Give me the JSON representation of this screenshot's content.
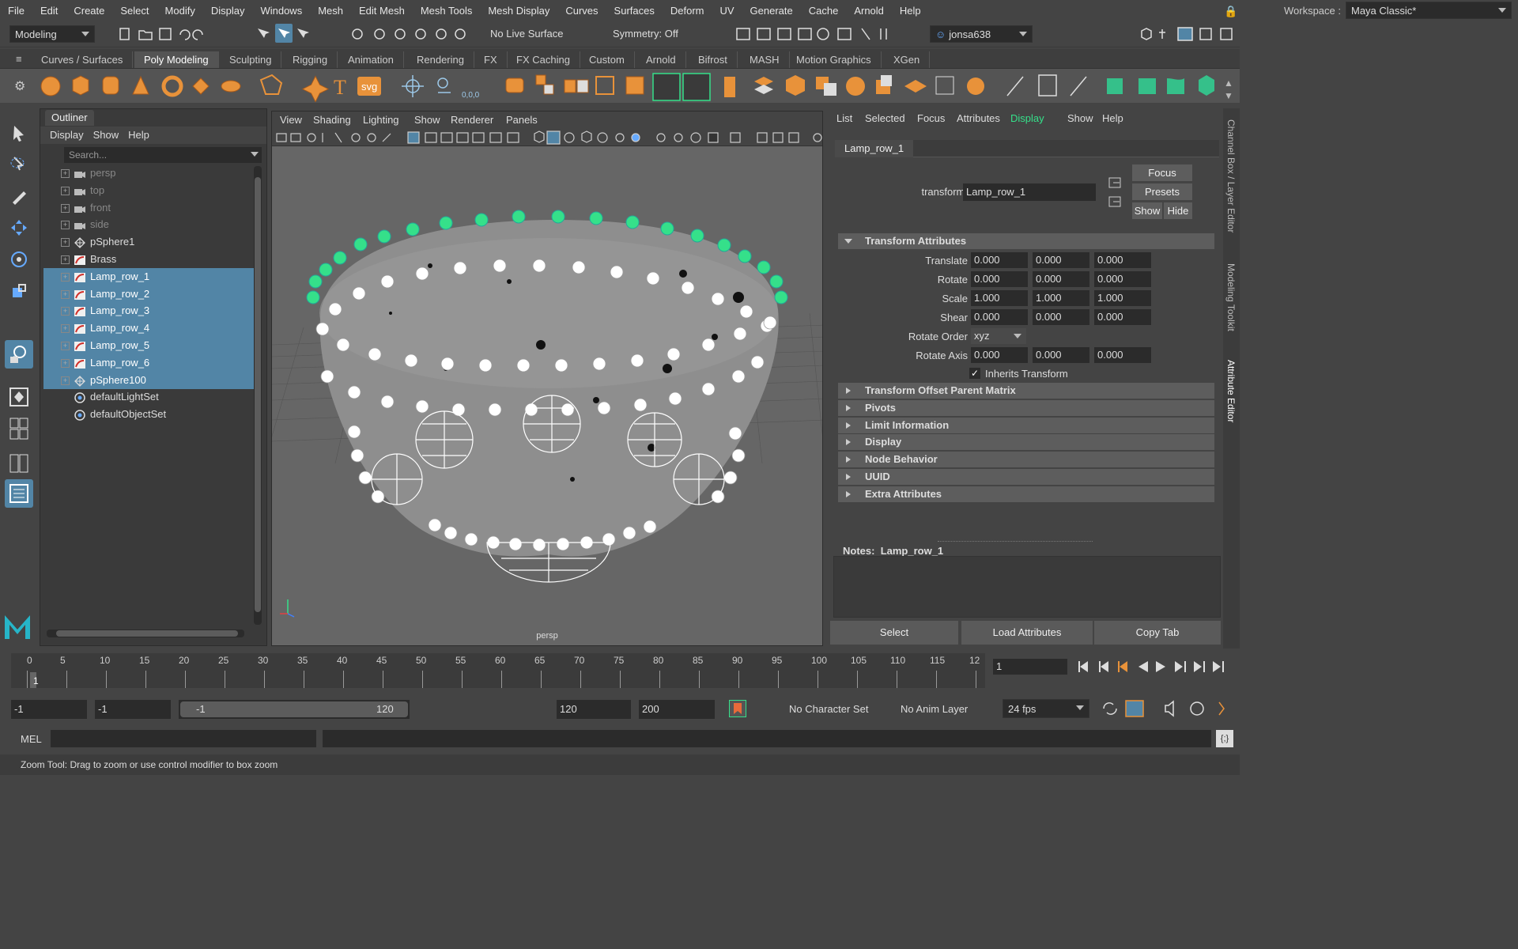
{
  "menubar": {
    "items": [
      "File",
      "Edit",
      "Create",
      "Select",
      "Modify",
      "Display",
      "Windows",
      "Mesh",
      "Edit Mesh",
      "Mesh Tools",
      "Mesh Display",
      "Curves",
      "Surfaces",
      "Deform",
      "UV",
      "Generate",
      "Cache",
      "Arnold",
      "Help"
    ],
    "workspace_label": "Workspace :",
    "workspace_value": "Maya Classic*"
  },
  "statusline": {
    "mode": "Modeling",
    "live_surface": "No Live Surface",
    "symmetry": "Symmetry: Off",
    "user": "jonsa638"
  },
  "shelf": {
    "tabs": [
      "Curves / Surfaces",
      "Poly Modeling",
      "Sculpting",
      "Rigging",
      "Animation",
      "Rendering",
      "FX",
      "FX Caching",
      "Custom",
      "Arnold",
      "Bifrost",
      "MASH",
      "Motion Graphics",
      "XGen"
    ],
    "active_tab": "Poly Modeling",
    "text_icons": {
      "type": "T",
      "svg": "svg",
      "coords": "0,0,0"
    }
  },
  "outliner": {
    "title": "Outliner",
    "menu": [
      "Display",
      "Show",
      "Help"
    ],
    "search_placeholder": "Search...",
    "rows": [
      {
        "name": "persp",
        "icon": "camera-icon",
        "selected": false,
        "dim": true,
        "expandable": true
      },
      {
        "name": "top",
        "icon": "camera-icon",
        "selected": false,
        "dim": true,
        "expandable": true
      },
      {
        "name": "front",
        "icon": "camera-icon",
        "selected": false,
        "dim": true,
        "expandable": true
      },
      {
        "name": "side",
        "icon": "camera-icon",
        "selected": false,
        "dim": true,
        "expandable": true
      },
      {
        "name": "pSphere1",
        "icon": "mesh-icon",
        "selected": false,
        "dim": false,
        "expandable": true
      },
      {
        "name": "Brass",
        "icon": "curve-icon",
        "selected": false,
        "dim": false,
        "expandable": true
      },
      {
        "name": "Lamp_row_1",
        "icon": "curve-icon",
        "selected": true,
        "dim": false,
        "expandable": true
      },
      {
        "name": "Lamp_row_2",
        "icon": "curve-icon",
        "selected": true,
        "dim": false,
        "expandable": true
      },
      {
        "name": "Lamp_row_3",
        "icon": "curve-icon",
        "selected": true,
        "dim": false,
        "expandable": true
      },
      {
        "name": "Lamp_row_4",
        "icon": "curve-icon",
        "selected": true,
        "dim": false,
        "expandable": true
      },
      {
        "name": "Lamp_row_5",
        "icon": "curve-icon",
        "selected": true,
        "dim": false,
        "expandable": true
      },
      {
        "name": "Lamp_row_6",
        "icon": "curve-icon",
        "selected": true,
        "dim": false,
        "expandable": true
      },
      {
        "name": "pSphere100",
        "icon": "mesh-icon",
        "selected": true,
        "dim": false,
        "expandable": true
      },
      {
        "name": "defaultLightSet",
        "icon": "set-icon",
        "selected": false,
        "dim": false,
        "expandable": false
      },
      {
        "name": "defaultObjectSet",
        "icon": "set-icon",
        "selected": false,
        "dim": false,
        "expandable": false
      }
    ]
  },
  "viewport": {
    "menu": [
      "View",
      "Shading",
      "Lighting",
      "Show",
      "Renderer",
      "Panels"
    ],
    "camera_label": "persp"
  },
  "attribute_editor": {
    "menu": [
      "List",
      "Selected",
      "Focus",
      "Attributes",
      "Display",
      "Show",
      "Help"
    ],
    "active_menu": "Display",
    "tab": "Lamp_row_1",
    "transform_label": "transform:",
    "transform_value": "Lamp_row_1",
    "buttons": {
      "focus": "Focus",
      "presets": "Presets",
      "show": "Show",
      "hide": "Hide"
    },
    "transform_section": "Transform Attributes",
    "translate": {
      "label": "Translate",
      "x": "0.000",
      "y": "0.000",
      "z": "0.000"
    },
    "rotate": {
      "label": "Rotate",
      "x": "0.000",
      "y": "0.000",
      "z": "0.000"
    },
    "scale": {
      "label": "Scale",
      "x": "1.000",
      "y": "1.000",
      "z": "1.000"
    },
    "shear": {
      "label": "Shear",
      "x": "0.000",
      "y": "0.000",
      "z": "0.000"
    },
    "rotate_order": {
      "label": "Rotate Order",
      "value": "xyz"
    },
    "rotate_axis": {
      "label": "Rotate Axis",
      "x": "0.000",
      "y": "0.000",
      "z": "0.000"
    },
    "inherits_transform": {
      "label": "Inherits Transform",
      "checked": true
    },
    "collapsed_sections": [
      "Transform Offset Parent Matrix",
      "Pivots",
      "Limit Information",
      "Display",
      "Node Behavior",
      "UUID",
      "Extra Attributes"
    ],
    "notes_label": "Notes:",
    "notes_name": "Lamp_row_1",
    "bottom_buttons": {
      "select": "Select",
      "load": "Load Attributes",
      "copy": "Copy Tab"
    }
  },
  "side_tabs": [
    "Channel Box / Layer Editor",
    "Modeling Toolkit",
    "Attribute Editor"
  ],
  "timeline": {
    "frames": [
      "0",
      "5",
      "10",
      "15",
      "20",
      "25",
      "30",
      "35",
      "40",
      "45",
      "50",
      "55",
      "60",
      "65",
      "70",
      "75",
      "80",
      "85",
      "90",
      "95",
      "100",
      "105",
      "110",
      "115",
      "12"
    ],
    "current_frame": "1",
    "current_frame_field": "1"
  },
  "range": {
    "start": "-1",
    "playback_start": "-1",
    "slider_start": "-1",
    "slider_end": "120",
    "playback_end": "120",
    "end": "200",
    "character_set": "No Character Set",
    "anim_layer": "No Anim Layer",
    "fps": "24 fps"
  },
  "mel": {
    "label": "MEL"
  },
  "help_line": "Zoom Tool: Drag to zoom or use control modifier to box zoom",
  "colors": {
    "selection": "#5285a6",
    "accent_green": "#35e08a",
    "panel": "#444444",
    "field": "#2b2b2b",
    "maya_logo": "#26b5c8"
  }
}
